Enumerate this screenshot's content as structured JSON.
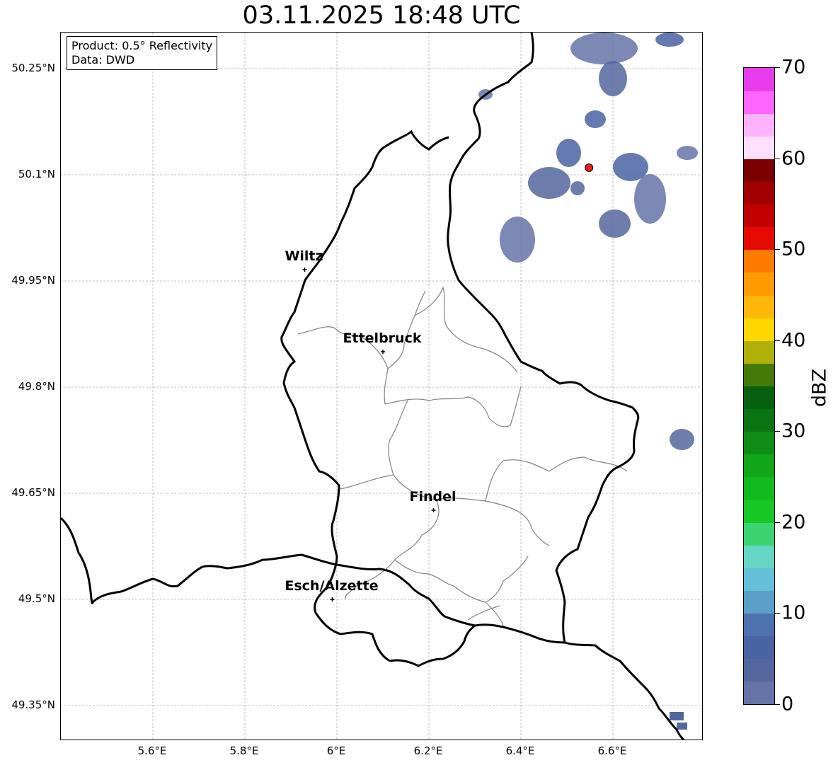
{
  "title": "03.11.2025 18:48 UTC",
  "info": {
    "product": "Product: 0.5° Reflectivity",
    "source": "Data: DWD"
  },
  "lat_ticks": [
    "50.25°N",
    "50.1°N",
    "49.95°N",
    "49.8°N",
    "49.65°N",
    "49.5°N",
    "49.35°N"
  ],
  "lon_ticks": [
    "5.6°E",
    "5.8°E",
    "6°E",
    "6.2°E",
    "6.4°E",
    "6.6°E"
  ],
  "cities": [
    {
      "name": "Wiltz",
      "lon": 5.93,
      "lat": 49.966
    },
    {
      "name": "Ettelbruck",
      "lon": 6.1,
      "lat": 49.85
    },
    {
      "name": "Findel",
      "lon": 6.21,
      "lat": 49.626
    },
    {
      "name": "Esch/Alzette",
      "lon": 5.99,
      "lat": 49.5
    }
  ],
  "radar_site": {
    "lon": 6.548,
    "lat": 50.11,
    "color": "#e8201a"
  },
  "colorbar": {
    "label": "dBZ",
    "min": 0,
    "max": 70,
    "tick_labels": [
      "0",
      "10",
      "20",
      "30",
      "40",
      "50",
      "60",
      "70"
    ],
    "colors": [
      "#6674a8",
      "#53679e",
      "#4a63a2",
      "#4d72ae",
      "#5b9ec8",
      "#66bfd9",
      "#66d6c4",
      "#3cd470",
      "#16c823",
      "#11bb1e",
      "#12a61a",
      "#0f8c16",
      "#0a7413",
      "#07600f",
      "#457a08",
      "#b0b008",
      "#ffd700",
      "#ffb80a",
      "#ff9a00",
      "#ff7c00",
      "#e60b00",
      "#c20000",
      "#a10000",
      "#7b0000",
      "#ffdfff",
      "#ffb3ff",
      "#ff66ff",
      "#e83cec"
    ]
  },
  "grid_color": "#b0b0b0",
  "border_color": "#000000",
  "canton_color": "#808080"
}
